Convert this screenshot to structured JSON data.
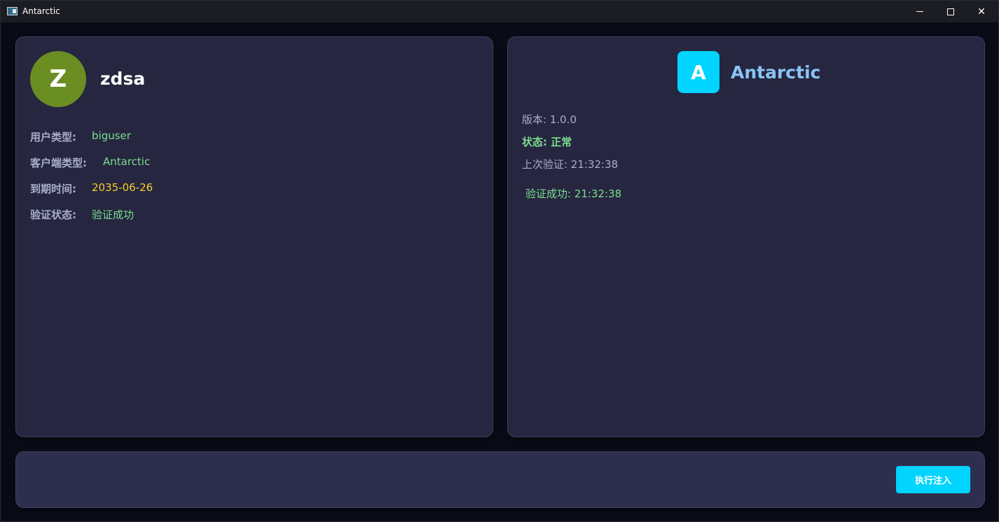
{
  "window": {
    "title": "Antarctic"
  },
  "user": {
    "avatar_letter": "Z",
    "name": "zdsa",
    "fields": [
      {
        "label": "用户类型:",
        "value": "biguser"
      },
      {
        "label": "客户端类型:",
        "value": "Antarctic"
      },
      {
        "label": "到期时间:",
        "value": "2035-06-26"
      },
      {
        "label": "验证状态:",
        "value": "验证成功"
      }
    ]
  },
  "app": {
    "badge_letter": "A",
    "name": "Antarctic",
    "version": "版本: 1.0.0",
    "status": "状态: 正常",
    "last_verify": "上次验证: 21:32:38",
    "verify_result": "验证成功: 21:32:38"
  },
  "actions": {
    "inject_label": "执行注入"
  },
  "colors": {
    "avatar": "#6b8e23",
    "accent": "#00d4ff",
    "app_name": "#89c4f4",
    "success": "#7ddc8f",
    "expiry": "#f6cf2c"
  },
  "icons": {
    "app": "app-window-icon",
    "minimize": "minimize-icon",
    "maximize": "maximize-icon",
    "close": "close-icon"
  }
}
